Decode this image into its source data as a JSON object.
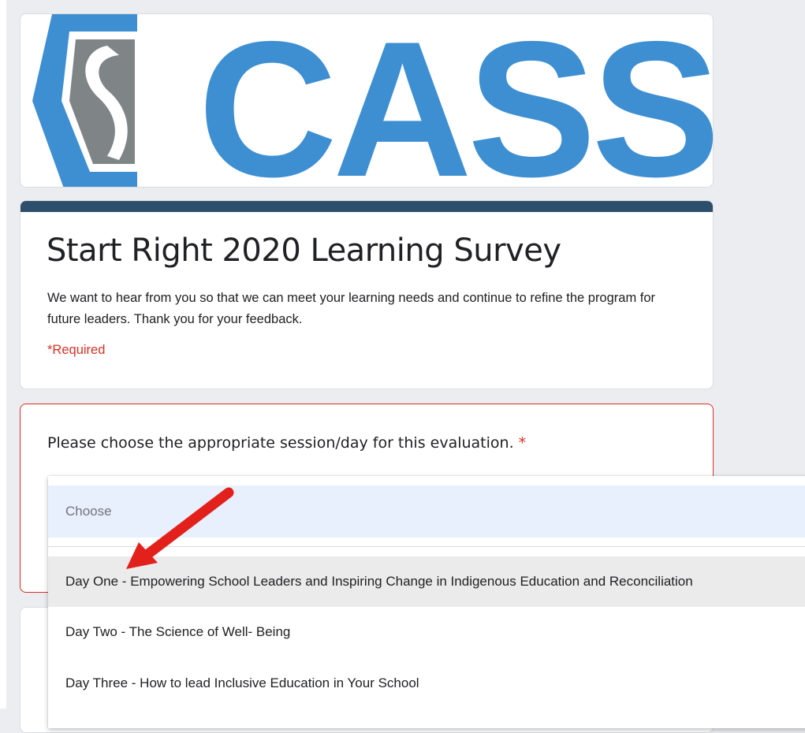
{
  "header": {
    "logo_text": "CASS",
    "brand_color": "#3e8fd2"
  },
  "form": {
    "title": "Start Right 2020 Learning Survey",
    "description": "We want to hear from you so that we can meet your learning needs and continue to refine the program for future leaders. Thank you for your feedback.",
    "required_note": "*Required",
    "accent_color": "#2d4f6c"
  },
  "question": {
    "text": "Please choose the appropriate session/day for this evaluation.",
    "required_marker": "*",
    "error_color": "#d93025"
  },
  "dropdown": {
    "placeholder": "Choose",
    "options": [
      "Day One - Empowering School Leaders and Inspiring Change in Indigenous Education and Reconciliation",
      "Day Two - The Science of Well- Being",
      "Day Three - How to lead Inclusive Education in Your School"
    ],
    "hovered_index": 0
  },
  "annotation": {
    "icon": "red-arrow-icon",
    "color": "#e3211c"
  }
}
